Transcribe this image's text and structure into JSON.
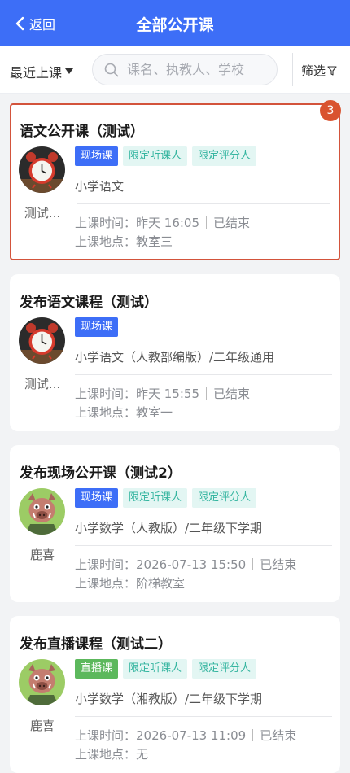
{
  "header": {
    "back_label": "返回",
    "title": "全部公开课"
  },
  "toolbar": {
    "sort_label": "最近上课",
    "search_placeholder": "课名、执教人、学校",
    "filter_label": "筛选"
  },
  "labels": {
    "time": "上课时间：",
    "place": "上课地点："
  },
  "courses": [
    {
      "title": "语文公开课（测试）",
      "teacher": "测试...",
      "avatar": "alarm-clock-icon",
      "tags": [
        "现场课",
        "限定听课人",
        "限定评分人"
      ],
      "subject": "小学语文",
      "time": "昨天 16:05",
      "status": "已结束",
      "place": "教室三",
      "badge": "3"
    },
    {
      "title": "发布语文课程（测试）",
      "teacher": "测试...",
      "avatar": "alarm-clock-icon",
      "tags": [
        "现场课"
      ],
      "subject": "小学语文（人教部编版）/二年级通用",
      "time": "昨天 15:55",
      "status": "已结束",
      "place": "教室一"
    },
    {
      "title": "发布现场公开课（测试2）",
      "teacher": "鹿喜",
      "avatar": "boar-icon",
      "tags": [
        "现场课",
        "限定听课人",
        "限定评分人"
      ],
      "subject": "小学数学（人教版）/二年级下学期",
      "time": "2026-07-13 15:50",
      "status": "已结束",
      "place": "阶梯教室"
    },
    {
      "title": "发布直播课程（测试二）",
      "teacher": "鹿喜",
      "avatar": "boar-icon",
      "tags": [
        "直播课",
        "限定听课人",
        "限定评分人"
      ],
      "subject": "小学数学（湘教版）/二年级下学期",
      "time": "2026-07-13 11:09",
      "status": "已结束",
      "place": "无"
    }
  ]
}
